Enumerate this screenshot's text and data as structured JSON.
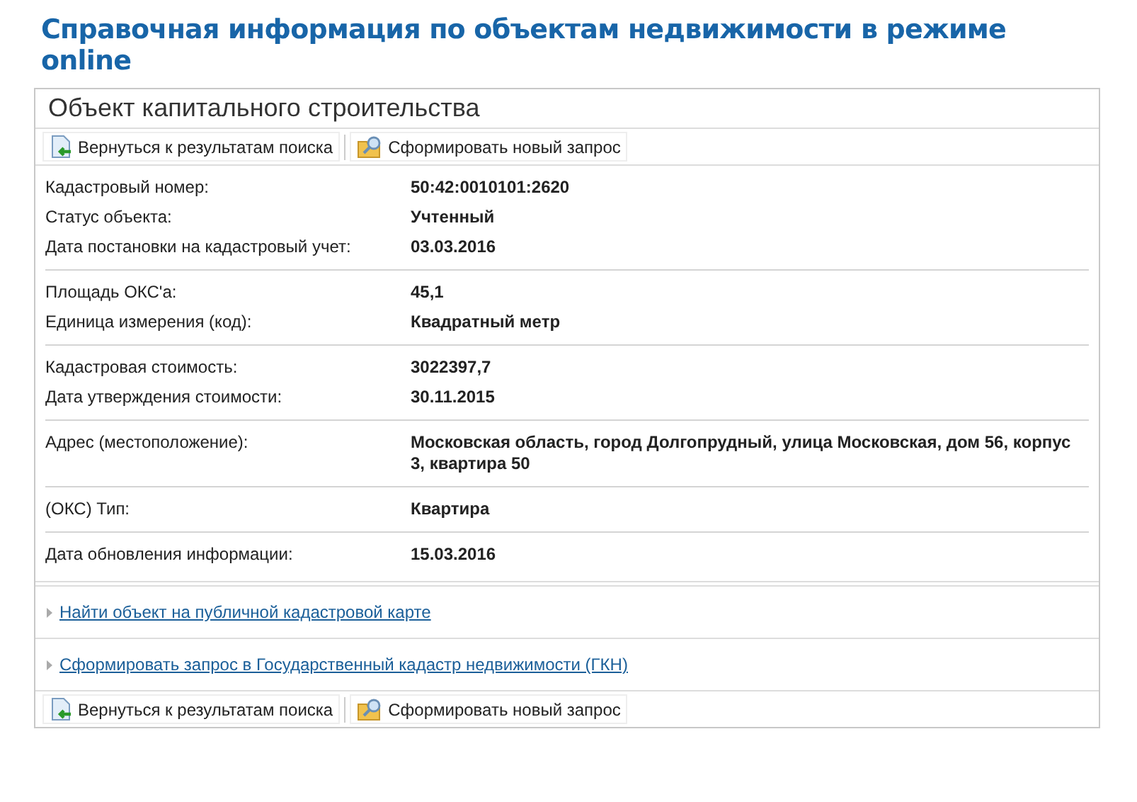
{
  "page_title": "Справочная информация по объектам недвижимости в режиме online",
  "panel_title": "Объект капитального строительства",
  "top_toolbar": [
    {
      "kind": "back",
      "label": "Вернуться к результатам поиска"
    },
    {
      "kind": "query",
      "label": "Сформировать новый запрос"
    }
  ],
  "groups": [
    [
      {
        "label": "Кадастровый номер:",
        "value": "50:42:0010101:2620"
      },
      {
        "label": "Статус объекта:",
        "value": "Учтенный"
      },
      {
        "label": "Дата постановки на кадастровый учет:",
        "value": "03.03.2016"
      }
    ],
    [
      {
        "label": "Площадь ОКС'а:",
        "value": "45,1"
      },
      {
        "label": "Единица измерения (код):",
        "value": "Квадратный метр"
      }
    ],
    [
      {
        "label": "Кадастровая стоимость:",
        "value": "3022397,7"
      },
      {
        "label": "Дата утверждения стоимости:",
        "value": "30.11.2015"
      }
    ],
    [
      {
        "label": "Адрес (местоположение):",
        "value": "Московская область, город Долгопрудный, улица Московская, дом 56, корпус 3, квартира 50"
      }
    ],
    [
      {
        "label": "(ОКС) Тип:",
        "value": "Квартира"
      }
    ],
    [
      {
        "label": "Дата обновления информации:",
        "value": "15.03.2016"
      }
    ]
  ],
  "links": [
    "Найти объект на публичной кадастровой карте",
    "Сформировать запрос в Государственный кадастр недвижимости (ГКН)"
  ],
  "bottom_toolbar": [
    {
      "kind": "back",
      "label": "Вернуться к результатам поиска"
    },
    {
      "kind": "query",
      "label": "Сформировать новый запрос"
    }
  ]
}
